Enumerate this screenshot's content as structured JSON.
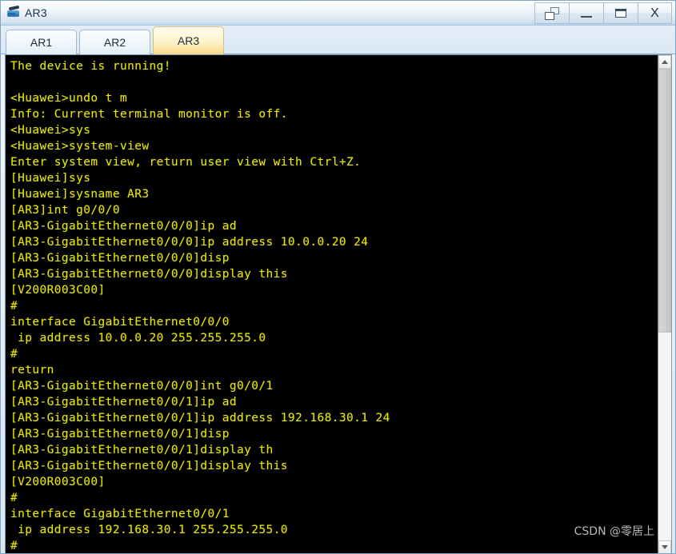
{
  "window": {
    "title": "AR3",
    "app_icon": "router-icon",
    "controls": [
      {
        "name": "restore-button",
        "icon": "restore-icon",
        "label": ""
      },
      {
        "name": "minimize-button",
        "icon": "minimize-icon",
        "label": ""
      },
      {
        "name": "maximize-button",
        "icon": "maximize-icon",
        "label": ""
      },
      {
        "name": "close-button",
        "icon": "close-icon",
        "label": "X"
      }
    ]
  },
  "tabs": [
    {
      "label": "AR1",
      "active": false
    },
    {
      "label": "AR2",
      "active": false
    },
    {
      "label": "AR3",
      "active": true
    }
  ],
  "terminal": {
    "foreground_color": "#e8e800",
    "background_color": "#000000",
    "lines": [
      "The device is running!",
      "",
      "<Huawei>undo t m",
      "Info: Current terminal monitor is off.",
      "<Huawei>sys",
      "<Huawei>system-view",
      "Enter system view, return user view with Ctrl+Z.",
      "[Huawei]sys",
      "[Huawei]sysname AR3",
      "[AR3]int g0/0/0",
      "[AR3-GigabitEthernet0/0/0]ip ad",
      "[AR3-GigabitEthernet0/0/0]ip address 10.0.0.20 24",
      "[AR3-GigabitEthernet0/0/0]disp",
      "[AR3-GigabitEthernet0/0/0]display this",
      "[V200R003C00]",
      "#",
      "interface GigabitEthernet0/0/0",
      " ip address 10.0.0.20 255.255.255.0",
      "#",
      "return",
      "[AR3-GigabitEthernet0/0/0]int g0/0/1",
      "[AR3-GigabitEthernet0/0/1]ip ad",
      "[AR3-GigabitEthernet0/0/1]ip address 192.168.30.1 24",
      "[AR3-GigabitEthernet0/0/1]disp",
      "[AR3-GigabitEthernet0/0/1]display th",
      "[AR3-GigabitEthernet0/0/1]display this",
      "[V200R003C00]",
      "#",
      "interface GigabitEthernet0/0/1",
      " ip address 192.168.30.1 255.255.255.0",
      "#"
    ]
  },
  "scrollbar": {
    "up_arrow": "chevron-up-icon",
    "down_arrow": "chevron-down-icon",
    "thumb_position_percent": 0,
    "thumb_size_percent": 56
  },
  "watermark": {
    "text": "CSDN @零居上"
  }
}
